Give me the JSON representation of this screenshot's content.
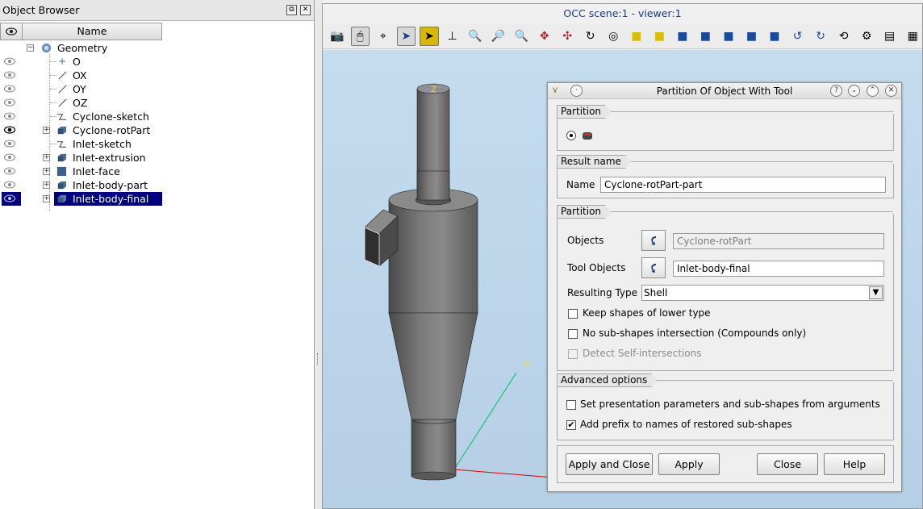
{
  "object_browser": {
    "title": "Object Browser",
    "column_name": "Name",
    "items": [
      {
        "label": "Geometry",
        "icon": "geometry-icon"
      },
      {
        "label": "O",
        "icon": "point-icon"
      },
      {
        "label": "OX",
        "icon": "line-icon"
      },
      {
        "label": "OY",
        "icon": "line-icon"
      },
      {
        "label": "OZ",
        "icon": "line-icon"
      },
      {
        "label": "Cyclone-sketch",
        "icon": "sketch-icon"
      },
      {
        "label": "Cyclone-rotPart",
        "icon": "solid-icon"
      },
      {
        "label": "Inlet-sketch",
        "icon": "sketch-icon"
      },
      {
        "label": "Inlet-extrusion",
        "icon": "solid-icon"
      },
      {
        "label": "Inlet-face",
        "icon": "face-icon"
      },
      {
        "label": "Inlet-body-part",
        "icon": "solid-icon"
      },
      {
        "label": "Inlet-body-final",
        "icon": "solid-icon"
      }
    ]
  },
  "viewer": {
    "title": "OCC scene:1 - viewer:1",
    "axis_y": "Y",
    "axis_z": "Z"
  },
  "dialog": {
    "title": "Partition Of Object With Tool",
    "group_partition_top": "Partition",
    "group_result": "Result name",
    "name_label": "Name",
    "name_value": "Cyclone-rotPart-part",
    "group_partition": "Partition",
    "objects_label": "Objects",
    "objects_value": "Cyclone-rotPart",
    "tool_objects_label": "Tool Objects",
    "tool_objects_value": "Inlet-body-final",
    "resulting_type_label": "Resulting Type",
    "resulting_type_value": "Shell",
    "keep_shapes_label": "Keep shapes of lower type",
    "keep_shapes_checked": false,
    "no_subshapes_label": "No sub-shapes intersection (Compounds only)",
    "no_subshapes_checked": false,
    "detect_self_label": "Detect Self-intersections",
    "detect_self_checked": false,
    "group_advanced": "Advanced options",
    "set_presentation_label": "Set presentation parameters and sub-shapes from arguments",
    "set_presentation_checked": false,
    "add_prefix_label": "Add prefix to names of restored sub-shapes",
    "add_prefix_checked": true,
    "buttons": {
      "apply_close": "Apply and Close",
      "apply": "Apply",
      "close": "Close",
      "help": "Help"
    }
  },
  "colors": {
    "selection": "#000080",
    "viewer_bg": "#c5dcef"
  }
}
